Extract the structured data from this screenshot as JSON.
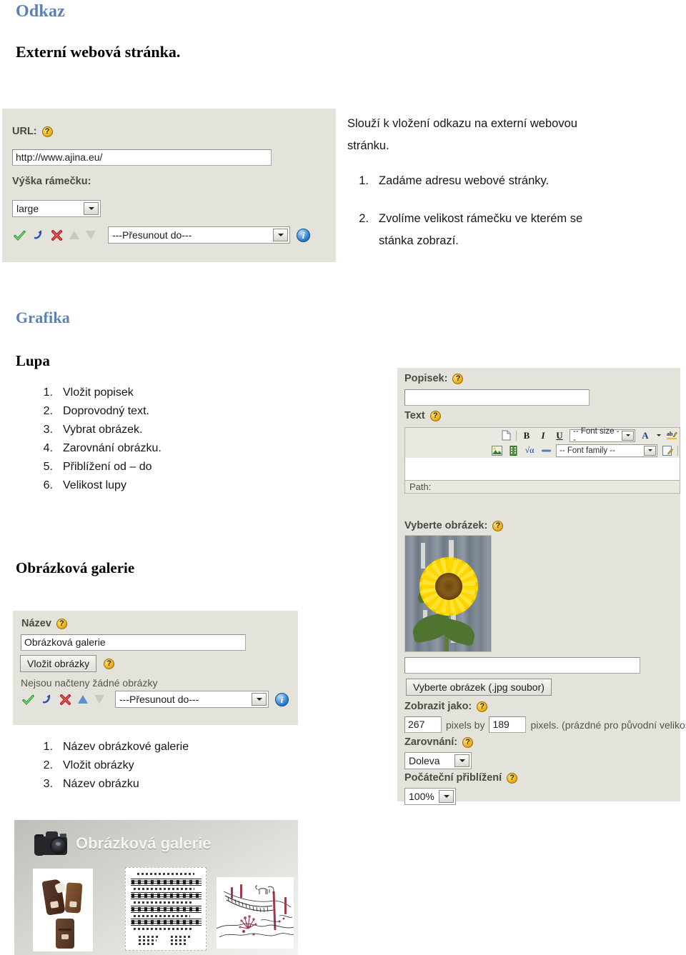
{
  "sections": {
    "odkaz_heading": "Odkaz",
    "odkaz_sub": "Externí webová stránka.",
    "grafika_heading": "Grafika",
    "lupa_heading": "Lupa",
    "gallery_heading": "Obrázková galerie"
  },
  "odkaz_text": {
    "intro_line1": "Slouží k vložení odkazu na externí webovou",
    "intro_line2": "stránku.",
    "steps": [
      {
        "num": "1.",
        "text": "Zadáme adresu webové stránky."
      },
      {
        "num": "2.",
        "text": "Zvolíme velikost rámečku ve kterém se",
        "text2": "stánka zobrazí."
      }
    ]
  },
  "link_form": {
    "url_label": "URL:",
    "help_glyph": "?",
    "url_value": "http://www.ajina.eu/",
    "height_label": "Výška rámečku:",
    "height_value": "large",
    "move_to_value": "---Přesunout do---",
    "info_glyph": "i",
    "icons": {
      "approve": "green-check-icon",
      "undo": "blue-undo-arrow-icon",
      "delete": "red-x-icon",
      "move_up": "triangle-up-icon",
      "move_down": "triangle-down-icon"
    }
  },
  "lupa_list": [
    {
      "num": "1.",
      "text": "Vložit popisek"
    },
    {
      "num": "2.",
      "text": "Doprovodný text."
    },
    {
      "num": "3.",
      "text": "Vybrat obrázek."
    },
    {
      "num": "4.",
      "text": "Zarovnání obrázku."
    },
    {
      "num": "5.",
      "text": "Přiblížení od – do"
    },
    {
      "num": "6.",
      "text": "Velikost lupy"
    }
  ],
  "lupa_form": {
    "caption_label": "Popisek:",
    "caption_value": "",
    "text_label": "Text",
    "path_label": "Path:",
    "toolbar": {
      "new_doc": "new-document-icon",
      "bold": "B",
      "italic": "I",
      "underline": "U",
      "font_size": "-- Font size --",
      "font_color": "A",
      "highlight": "ab",
      "image": "insert-image-icon",
      "media": "insert-media-icon",
      "formula": "√α",
      "hr": "horizontal-rule-icon",
      "font_family": "-- Font family --",
      "edit_source": "edit-source-icon"
    },
    "pick_image_label": "Vyberte obrázek:",
    "file_value": "",
    "pick_image_button": "Vyberte obrázek (.jpg soubor)",
    "show_as_label": "Zobrazit jako:",
    "width_value": "267",
    "pixels_by": "pixels by",
    "height_value": "189",
    "pixels_note": "pixels. (prázdné pro původní velikost)",
    "align_label": "Zarovnání:",
    "align_value": "Doleva",
    "zoom_label": "Počáteční přiblížení",
    "zoom_value": "100%"
  },
  "gallery_form": {
    "name_label": "Název",
    "name_value": "Obrázková galerie",
    "insert_button": "Vložit obrázky",
    "empty_note": "Nejsou načteny žádné obrázky",
    "move_to_value": "---Přesunout do---",
    "info_glyph": "i"
  },
  "gallery_list": [
    {
      "num": "1.",
      "text": "Název obrázkové galerie"
    },
    {
      "num": "2.",
      "text": "Vložit obrázky"
    },
    {
      "num": "3.",
      "text": "Název obrázku"
    }
  ],
  "gallery_widget": {
    "title": "Obrázková galerie",
    "camera_icon": "camera-icon",
    "thumbs": [
      {
        "name": "thumb-leather-cases"
      },
      {
        "name": "thumb-sheet-music"
      },
      {
        "name": "thumb-bridge-drawing"
      }
    ]
  },
  "colors": {
    "heading_blue": "#5a81b4",
    "panel_grey": "#e3e2db",
    "help_yellow": "#e8a90c",
    "info_blue": "#2b7fd0"
  }
}
